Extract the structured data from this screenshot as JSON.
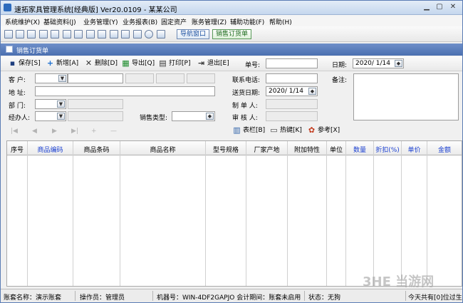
{
  "window": {
    "title": "速拓家具管理系统[经典版] Ver20.0109  -  某某公司",
    "controls": [
      "minimize-icon",
      "maximize-icon",
      "close-icon"
    ]
  },
  "menu": [
    "系统维护(X)",
    "基础资料(J)",
    "业务管理(Y)",
    "业务报表(B)",
    "固定资产",
    "账务管理(Z)",
    "辅助功能(F)",
    "帮助(H)"
  ],
  "toolbar": {
    "nav_window": "导航窗口",
    "sales_order": "销售订货单"
  },
  "panel": {
    "title": "销售订货单"
  },
  "actions": {
    "save": "保存[S]",
    "add": "新增[A]",
    "delete": "删除[D]",
    "export": "导出[Q]",
    "print": "打印[P]",
    "exit": "退出[E]"
  },
  "form": {
    "order_no_label": "单号:",
    "order_no_value": "",
    "date_label": "日期:",
    "date_value": "2020/ 1/14",
    "customer_label": "客    户:",
    "address_label": "地    址:",
    "dept_label": "部    门:",
    "handler_label": "经办人:",
    "sales_type_label": "销售类型:",
    "phone_label": "联系电话:",
    "delivery_label": "送货日期:",
    "delivery_value": "2020/ 1/14",
    "maker_label": "制 单 人:",
    "auditor_label": "审 核 人:",
    "memo_label": "备注:"
  },
  "subtoolbar": {
    "nav": [
      "|◀",
      "◀",
      "▶",
      "▶|",
      "+",
      "—"
    ],
    "columns_btn": "表栏[B]",
    "hotkey_btn": "热键[K]",
    "ref_btn": "参考[X]"
  },
  "table": {
    "columns": [
      {
        "label": "序号",
        "blue": false
      },
      {
        "label": "商品编码",
        "blue": true
      },
      {
        "label": "商品条码",
        "blue": false
      },
      {
        "label": "商品名称",
        "blue": false
      },
      {
        "label": "型号规格",
        "blue": false
      },
      {
        "label": "厂家产地",
        "blue": false
      },
      {
        "label": "附加特性",
        "blue": false
      },
      {
        "label": "单位",
        "blue": false
      },
      {
        "label": "数量",
        "blue": true
      },
      {
        "label": "折扣(%)",
        "blue": true
      },
      {
        "label": "单价",
        "blue": true
      },
      {
        "label": "金额",
        "blue": true
      }
    ]
  },
  "status": {
    "account": "账套名称：演示账套",
    "operator": "操作员：管理员",
    "machine": "机器号：WIN-4DF2GAPJO 会计期间：账套未启用",
    "state": "状态：无狗",
    "expire": "今天共有[0]位过生!"
  },
  "watermark": "当游网"
}
